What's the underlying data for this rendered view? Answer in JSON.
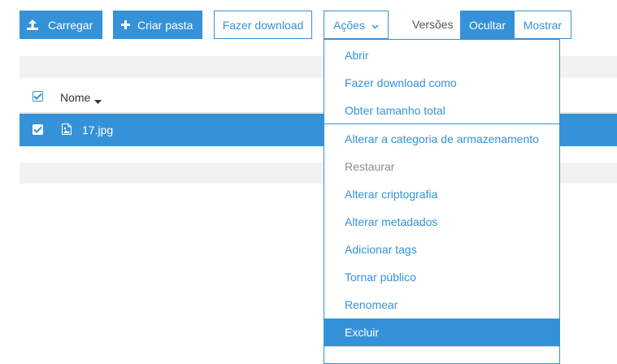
{
  "toolbar": {
    "upload_label": "Carregar",
    "create_folder_label": "Criar pasta",
    "download_label": "Fazer download",
    "actions_label": "Ações",
    "versions_label": "Versões",
    "hide_label": "Ocultar",
    "show_label": "Mostrar"
  },
  "table": {
    "name_header": "Nome",
    "rows": [
      {
        "name": "17.jpg",
        "selected": true
      }
    ]
  },
  "actions_menu": {
    "items": [
      {
        "label": "Abrir",
        "state": "normal"
      },
      {
        "label": "Fazer download como",
        "state": "normal"
      },
      {
        "label": "Obter tamanho total",
        "state": "normal"
      },
      {
        "label": "Alterar a categoria de armazenamento",
        "state": "normal"
      },
      {
        "label": "Restaurar",
        "state": "disabled"
      },
      {
        "label": "Alterar criptografia",
        "state": "normal"
      },
      {
        "label": "Alterar metadados",
        "state": "normal"
      },
      {
        "label": "Adicionar tags",
        "state": "normal"
      },
      {
        "label": "Tornar público",
        "state": "normal"
      },
      {
        "label": "Renomear",
        "state": "normal"
      },
      {
        "label": "Excluir",
        "state": "highlighted"
      }
    ]
  },
  "colors": {
    "accent": "#3592d8",
    "strip": "#f2f2f2",
    "disabled_text": "#8c8c8c"
  }
}
